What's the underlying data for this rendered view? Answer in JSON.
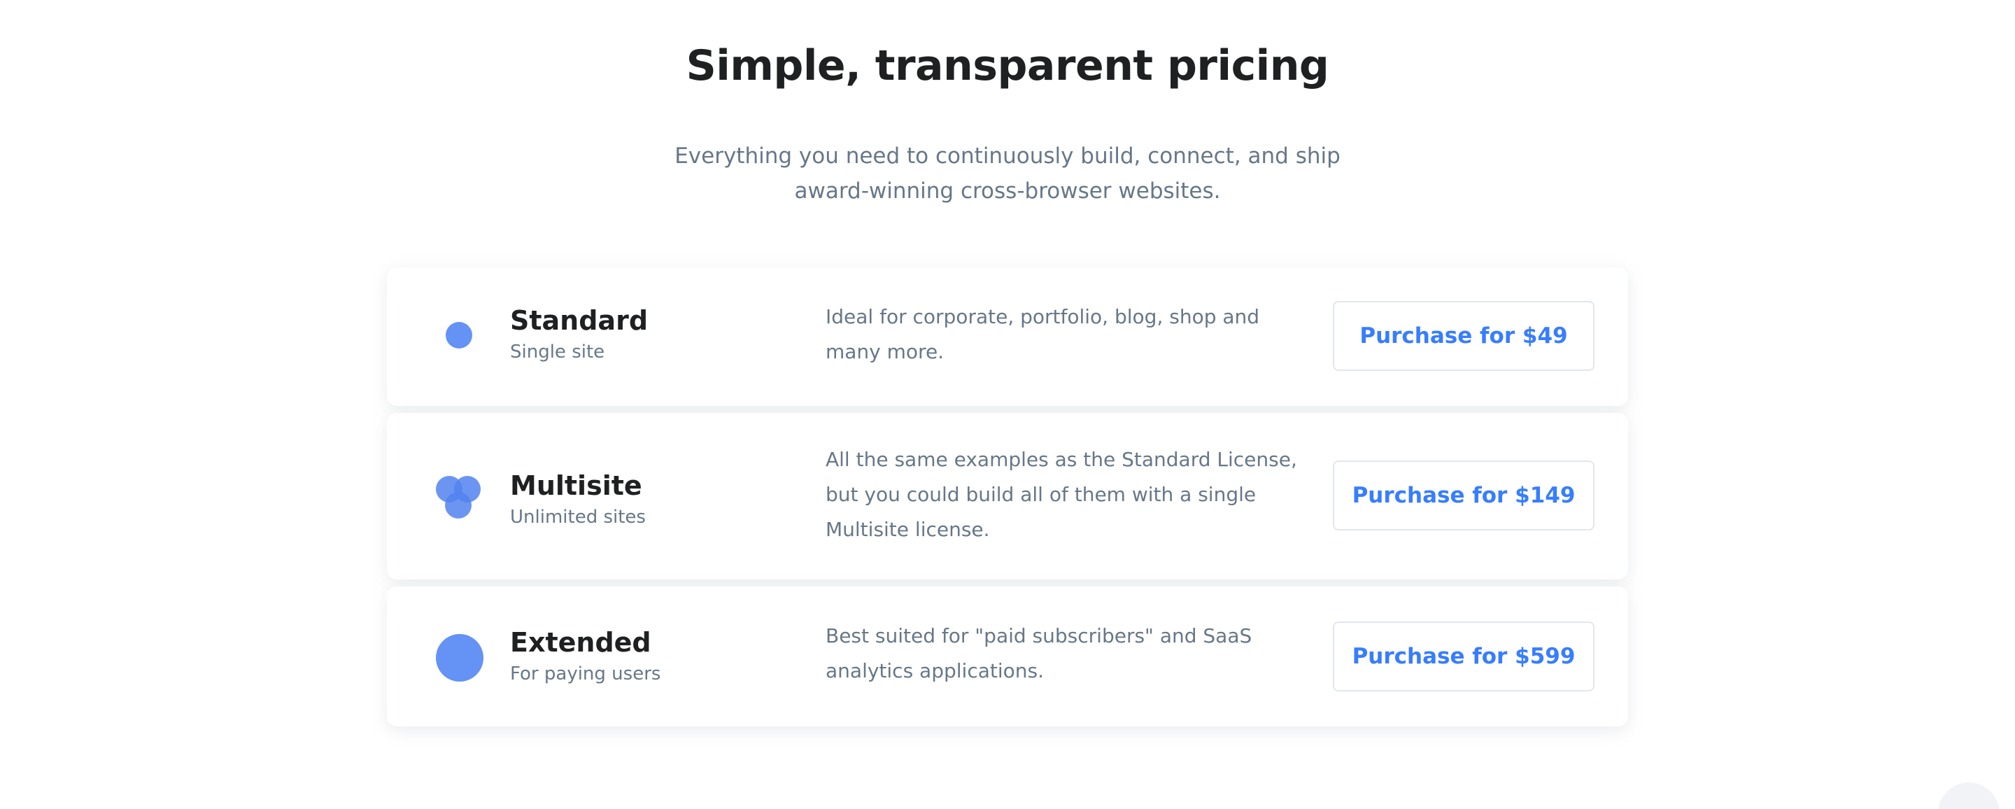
{
  "header": {
    "title": "Simple, transparent pricing",
    "subtitle": "Everything you need to continuously build, connect, and ship award-winning cross-browser websites."
  },
  "plans": [
    {
      "name": "Standard",
      "subtitle": "Single site",
      "description": "Ideal for corporate, portfolio, blog, shop and many more.",
      "button_label": "Purchase for $49",
      "icon": "single-circle-icon"
    },
    {
      "name": "Multisite",
      "subtitle": "Unlimited sites",
      "description": "All the same examples as the Standard License, but you could build all of them with a single Multisite license.",
      "button_label": "Purchase for $149",
      "icon": "three-circles-icon"
    },
    {
      "name": "Extended",
      "subtitle": "For paying users",
      "description": "Best suited for \"paid subscribers\" and SaaS analytics applications.",
      "button_label": "Purchase for $599",
      "icon": "large-circle-icon"
    }
  ],
  "colors": {
    "accent": "#377dff",
    "icon": "#6492f5",
    "text": "#1e2022",
    "muted": "#677788"
  }
}
